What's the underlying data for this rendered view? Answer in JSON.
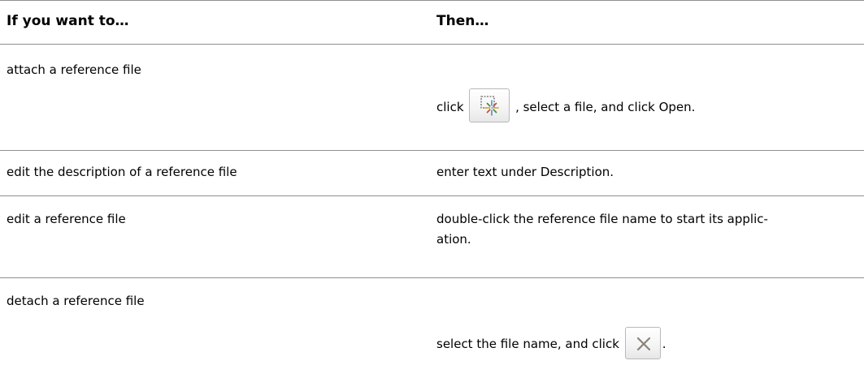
{
  "table": {
    "headers": {
      "left": "If you want to…",
      "right": "Then…"
    },
    "rows": [
      {
        "left": "attach a reference file",
        "right_prefix": "click",
        "right_icon": "attach-reference-icon",
        "right_suffix": ", select a file, and click Open."
      },
      {
        "left": "edit the description of a reference file",
        "right": "enter text under Description."
      },
      {
        "left": "edit a reference file",
        "right_line1": "double-click the reference file name to start its applic-",
        "right_line2": "ation."
      },
      {
        "left": "detach a reference file",
        "right_prefix": "select the file name, and click",
        "right_icon": "detach-x-icon",
        "right_suffix": "."
      }
    ]
  }
}
